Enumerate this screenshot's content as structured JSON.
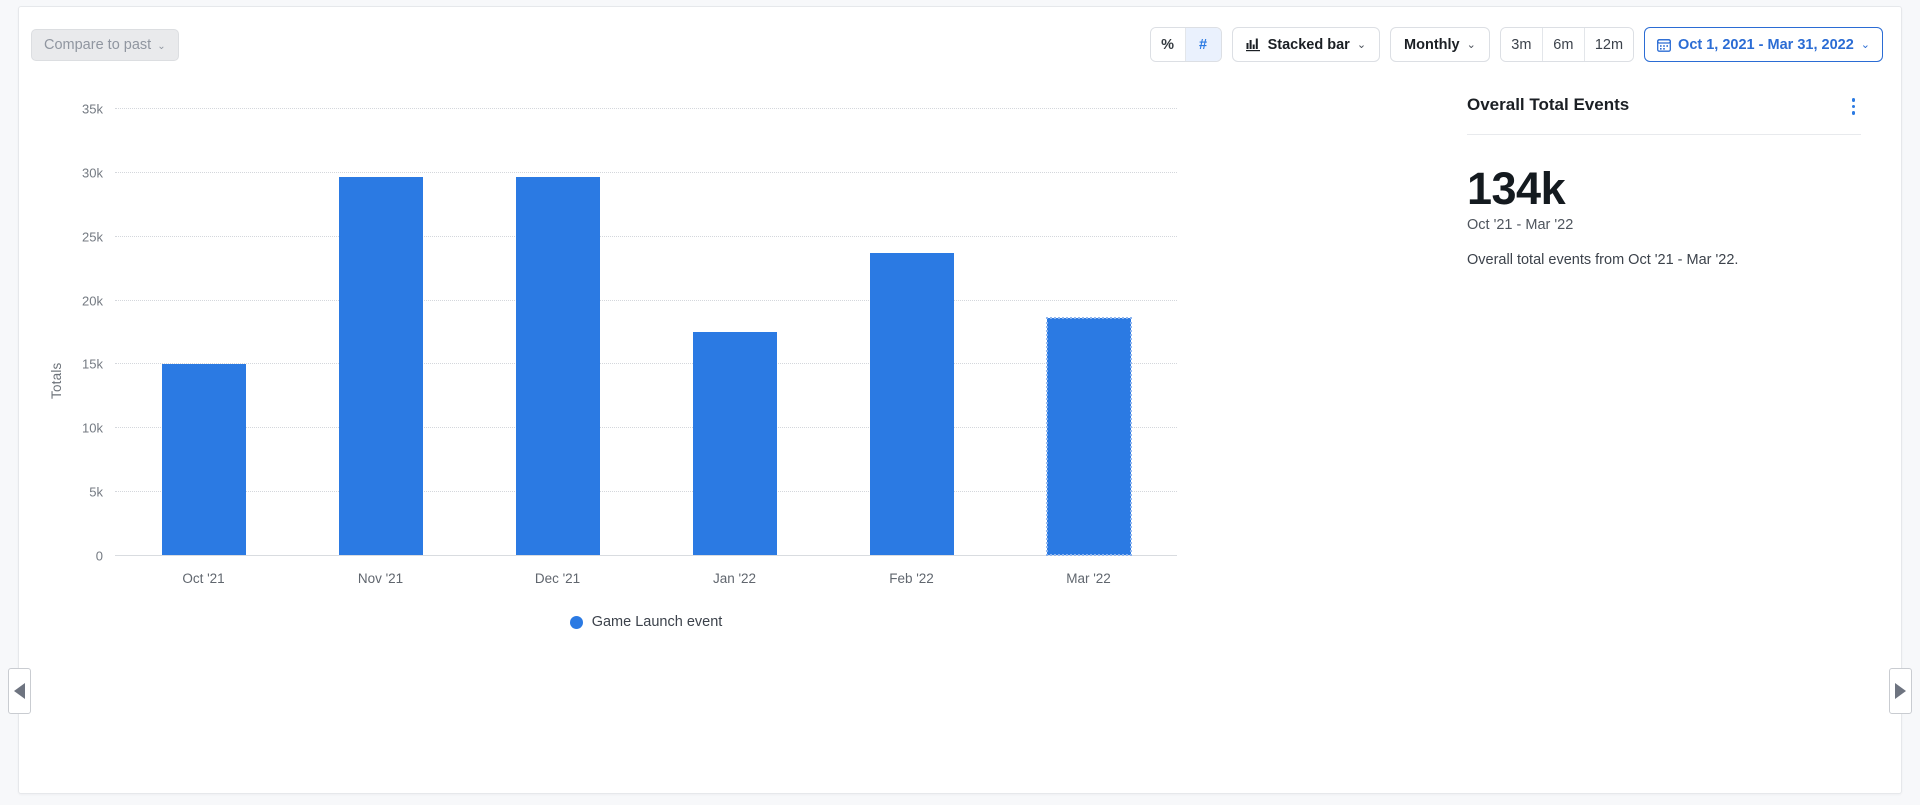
{
  "toolbar": {
    "compare_label": "Compare to past",
    "compare_caret": "⌄",
    "metric_toggle": [
      {
        "label": "%",
        "active": false
      },
      {
        "label": "#",
        "active": true
      }
    ],
    "chart_type": {
      "label": "Stacked bar",
      "icon": "stacked-bar-icon",
      "caret": "⌄"
    },
    "granularity": {
      "label": "Monthly",
      "caret": "⌄"
    },
    "ranges": [
      {
        "label": "3m"
      },
      {
        "label": "6m"
      },
      {
        "label": "12m"
      }
    ],
    "date_range": {
      "label": "Oct 1, 2021 - Mar 31, 2022",
      "icon": "calendar-icon",
      "caret": "⌄"
    }
  },
  "nav": {
    "prev_label": "◀",
    "next_label": "▶"
  },
  "side_panel": {
    "title": "Overall Total Events",
    "menu_icon": "kebab-menu-icon",
    "value": "134k",
    "value_range": "Oct '21 - Mar '22",
    "description": "Overall total events from Oct '21 - Mar '22."
  },
  "chart_data": {
    "type": "bar",
    "title": "",
    "xlabel": "",
    "ylabel": "Totals",
    "ylim": [
      0,
      35000
    ],
    "ytick_values": [
      0,
      5000,
      10000,
      15000,
      20000,
      25000,
      30000,
      35000
    ],
    "ytick_labels": [
      "0",
      "5k",
      "10k",
      "15k",
      "20k",
      "25k",
      "30k",
      "35k"
    ],
    "categories": [
      "Oct '21",
      "Nov '21",
      "Dec '21",
      "Jan '22",
      "Feb '22",
      "Mar '22"
    ],
    "series": [
      {
        "name": "Game Launch event",
        "color": "#2b7ae3",
        "values": [
          14950,
          29600,
          29580,
          17450,
          23650,
          18550
        ]
      }
    ],
    "partial_last_bar": true,
    "grid": true,
    "legend": {
      "position": "bottom",
      "entries": [
        "Game Launch event"
      ]
    }
  }
}
